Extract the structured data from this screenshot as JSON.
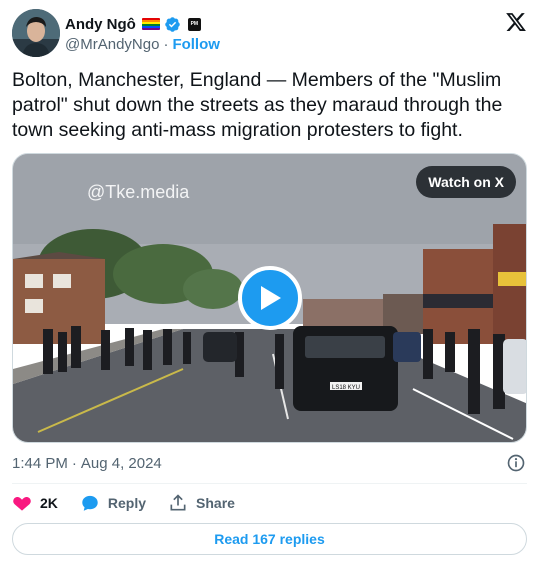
{
  "author": {
    "name": "Andy Ngô",
    "handle": "@MrAndyNgo",
    "separator": "·",
    "follow_label": "Follow",
    "badge_text": "PM"
  },
  "tweet": {
    "text": "Bolton, Manchester, England — Members of the \"Muslim patrol\" shut down the streets as they maraud through the town seeking anti-mass migration protesters to fight."
  },
  "media": {
    "watermark": "@Tke.media",
    "watch_label": "Watch on X",
    "plate": "LS18 KYU"
  },
  "meta": {
    "time": "1:44 PM",
    "separator": "·",
    "date": "Aug 4, 2024"
  },
  "actions": {
    "likes": "2K",
    "reply_label": "Reply",
    "share_label": "Share"
  },
  "footer": {
    "read_replies_label": "Read 167 replies"
  },
  "colors": {
    "accent": "#1d9bf0",
    "like": "#f91880",
    "text": "#0f1419",
    "muted": "#536471"
  }
}
